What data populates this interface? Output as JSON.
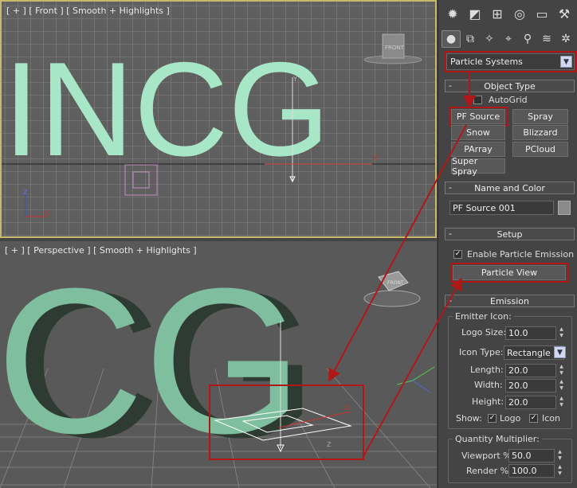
{
  "viewports": {
    "front_label": "[ + ] [ Front ] [ Smooth + Highlights ]",
    "persp_label": "[ + ] [ Perspective ] [ Smooth + Highlights ]",
    "front_text": "INCG",
    "persp_text": "CG",
    "viewcube_label": "FRONT",
    "axis_x": "X",
    "axis_y": "Y",
    "axis_z": "Z"
  },
  "panel": {
    "tabs": [
      "create-icon",
      "modify-icon",
      "hierarchy-icon",
      "motion-icon",
      "display-icon",
      "utilities-icon"
    ],
    "subtabs": [
      "geometry-icon",
      "shapes-icon",
      "lights-icon",
      "cameras-icon",
      "helpers-icon",
      "spacewarps-icon",
      "systems-icon"
    ],
    "dropdown": "Particle Systems",
    "object_type": {
      "title": "Object Type",
      "autogrid": "AutoGrid",
      "buttons": [
        "PF Source",
        "Spray",
        "Snow",
        "Blizzard",
        "PArray",
        "PCloud",
        "Super Spray"
      ]
    },
    "name_color": {
      "title": "Name and Color",
      "name_value": "PF Source 001",
      "swatch_color": "#8a8a8a"
    },
    "setup": {
      "title": "Setup",
      "enable_label": "Enable Particle Emission",
      "particle_view": "Particle View"
    },
    "emission": {
      "title": "Emission",
      "emitter_icon": "Emitter Icon:",
      "logo_size_label": "Logo Size:",
      "logo_size": "10.0",
      "icon_type_label": "Icon Type:",
      "icon_type": "Rectangle",
      "length_label": "Length:",
      "length": "20.0",
      "width_label": "Width:",
      "width": "20.0",
      "height_label": "Height:",
      "height": "20.0",
      "show_label": "Show:",
      "show_logo": "Logo",
      "show_icon": "Icon",
      "qty_label": "Quantity Multiplier:",
      "viewport_label": "Viewport %",
      "viewport": "50.0",
      "render_label": "Render %",
      "render": "100.0"
    }
  },
  "colors": {
    "text_color": "#a8e6c8",
    "highlight": "#b01818",
    "grid": "#8a8a8a",
    "viewport_bg": "#5f5f5f"
  }
}
